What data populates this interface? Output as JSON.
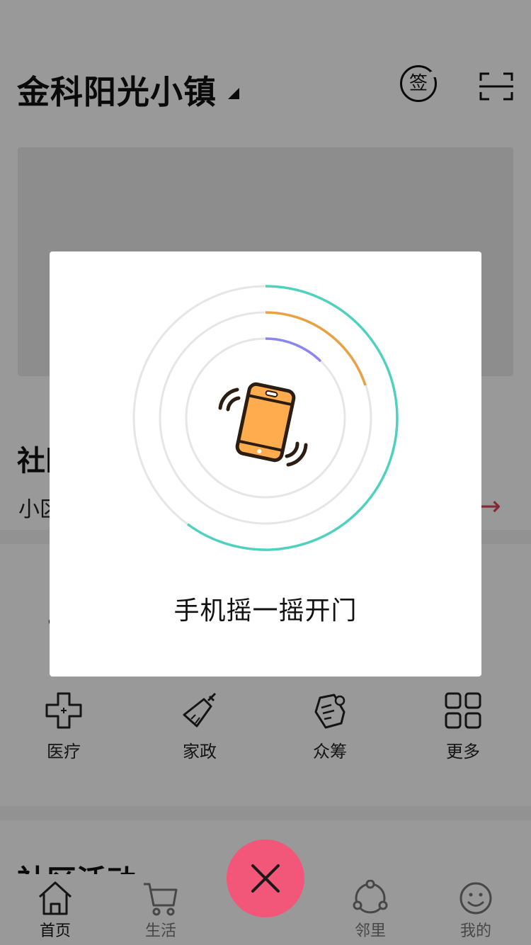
{
  "header": {
    "community_name": "金科阳光小镇",
    "signin_label": "签"
  },
  "notice": {
    "heading": "社区",
    "text": "小区"
  },
  "services": [
    {
      "label": "医疗",
      "icon": "medical-cross-icon"
    },
    {
      "label": "家政",
      "icon": "broom-icon"
    },
    {
      "label": "众筹",
      "icon": "crowdfunding-icon"
    },
    {
      "label": "更多",
      "icon": "grid-icon"
    }
  ],
  "activity": {
    "heading": "社区活动"
  },
  "tabs": [
    {
      "label": "首页",
      "icon": "home-icon",
      "active": true
    },
    {
      "label": "生活",
      "icon": "cart-icon",
      "active": false
    },
    {
      "label": "邻里",
      "icon": "share-nodes-icon",
      "active": false
    },
    {
      "label": "我的",
      "icon": "smile-icon",
      "active": false
    }
  ],
  "modal": {
    "message": "手机摇一摇开门"
  },
  "colors": {
    "accent_pink": "#f2577a",
    "ring_teal": "#4fd1c0",
    "ring_orange": "#e8a244",
    "ring_purple": "#8b85f0",
    "phone_orange": "#ffac4e",
    "notice_arrow": "#e0435a"
  }
}
